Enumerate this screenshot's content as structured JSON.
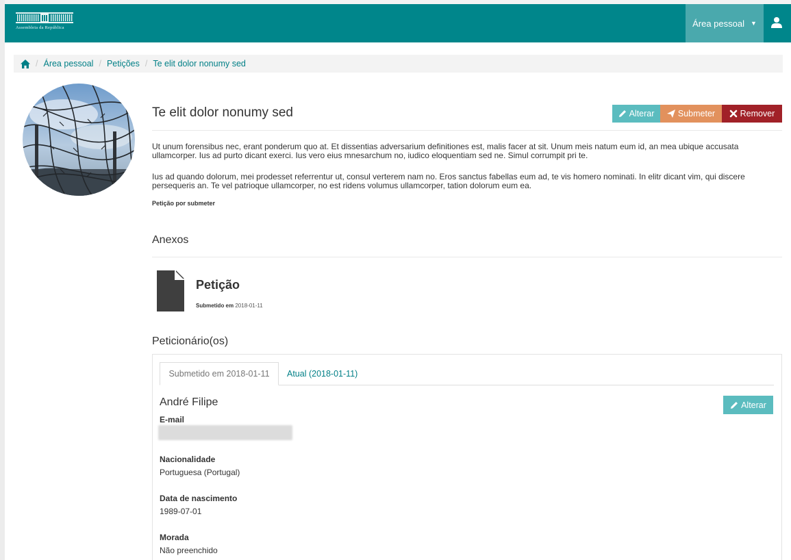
{
  "header": {
    "logo_text": "Assembleia da República",
    "user_menu_label": "Área pessoal",
    "colors": {
      "bar": "#00868b",
      "user_menu": "#4aa9ad",
      "link": "#007f86"
    }
  },
  "breadcrumb": {
    "items": [
      "Área pessoal",
      "Petições",
      "Te elit dolor nonumy sed"
    ]
  },
  "petition": {
    "title": "Te elit dolor nonumy sed",
    "actions": {
      "edit": "Alterar",
      "submit": "Submeter",
      "remove": "Remover"
    },
    "action_colors": {
      "edit": "#5bbcbf",
      "submit": "#e2915d",
      "remove": "#a12128"
    },
    "paragraphs": [
      "Ut unum forensibus nec, erant ponderum quo at. Et dissentias adversarium definitiones est, malis facer at sit. Unum meis natum eum id, an mea ubique accusata ullamcorper. Ius ad purto dicant exerci. Ius vero eius mnesarchum no, iudico eloquentiam sed ne. Simul corrumpit pri te.",
      "Ius ad quando dolorum, mei prodesset referrentur ut, consul verterem nam no. Eros sanctus fabellas eum ad, te vis homero nominati. In elitr dicant vim, qui discere persequeris an. Te vel patrioque ullamcorper, no est ridens volumus ullamcorper, tation dolorum eum ea."
    ],
    "status": "Petição por submeter"
  },
  "attachments": {
    "heading": "Anexos",
    "items": [
      {
        "name": "Petição",
        "meta_label": "Submetido em",
        "meta_date": "2018-01-11",
        "icon": "file-icon"
      }
    ]
  },
  "petitioners": {
    "heading": "Peticionário(os)",
    "tabs": [
      "Submetido em 2018-01-11",
      "Atual (2018-01-11)"
    ],
    "person": {
      "name": "André Filipe",
      "edit_label": "Alterar",
      "fields": [
        {
          "label": "E-mail",
          "value": ""
        },
        {
          "label": "Nacionalidade",
          "value": "Portuguesa (Portugal)"
        },
        {
          "label": "Data de nascimento",
          "value": "1989-07-01"
        },
        {
          "label": "Morada",
          "value": "Não preenchido"
        }
      ]
    }
  }
}
